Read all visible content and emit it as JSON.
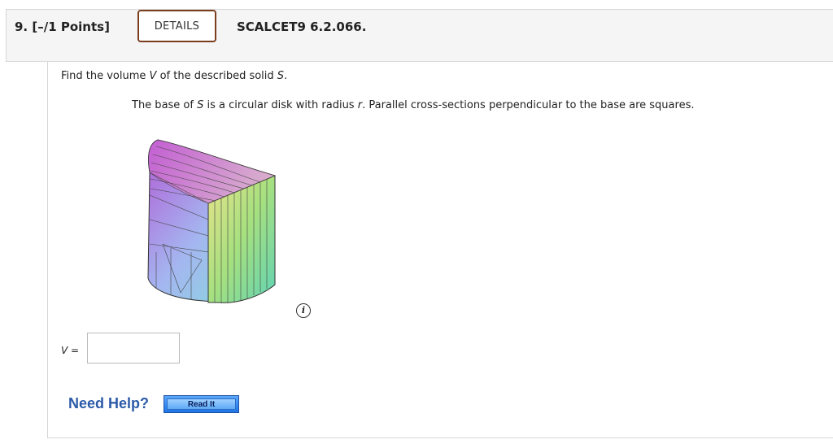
{
  "question": {
    "number_points": "9. [–/1 Points]",
    "details_label": "DETAILS",
    "source": "SCALCET9 6.2.066."
  },
  "prompt": {
    "pre": "Find the volume ",
    "var_v": "V",
    "mid": " of the described solid ",
    "var_s": "S",
    "post": "."
  },
  "description": {
    "pre": "The base of ",
    "var_s": "S",
    "mid": " is a circular disk with radius ",
    "var_r": "r",
    "post": ". Parallel cross-sections perpendicular to the base are squares."
  },
  "info_icon": {
    "icon": "info-icon",
    "glyph": "i"
  },
  "answer": {
    "var": "V",
    "equals": " =",
    "value": ""
  },
  "help": {
    "label": "Need Help?",
    "read_it_label": "Read It"
  },
  "colors": {
    "details_border": "#7a3e1d",
    "help_text": "#2c5aa8",
    "read_it_button": "#3b8df0"
  }
}
